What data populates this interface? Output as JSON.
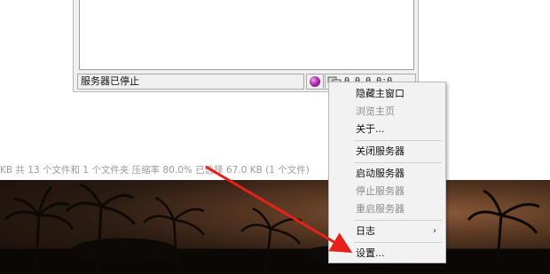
{
  "explorer": {
    "status_text": "KB 共 13 个文件和 1 个文件夹 压缩率 80.0% 已选择 67.0 KB (1 个文件)"
  },
  "app": {
    "status_bar": {
      "server_status": "服务器已停止",
      "network_address": "0.0.0.0:0"
    }
  },
  "context_menu": {
    "items": [
      {
        "label": "隐藏主窗口",
        "enabled": true
      },
      {
        "label": "浏览主页",
        "enabled": false
      },
      {
        "label": "关于...",
        "enabled": true
      },
      {
        "label": "关闭服务器",
        "enabled": true
      },
      {
        "label": "启动服务器",
        "enabled": true
      },
      {
        "label": "停止服务器",
        "enabled": false
      },
      {
        "label": "重启服务器",
        "enabled": false
      },
      {
        "label": "日志",
        "enabled": true,
        "submenu": true
      },
      {
        "label": "设置...",
        "enabled": true
      }
    ]
  },
  "colors": {
    "annotation_arrow": "#e8201c",
    "status_dot": "#b02fb0"
  },
  "icons": [
    "status-dot-icon",
    "network-icon",
    "submenu-chevron-icon"
  ]
}
